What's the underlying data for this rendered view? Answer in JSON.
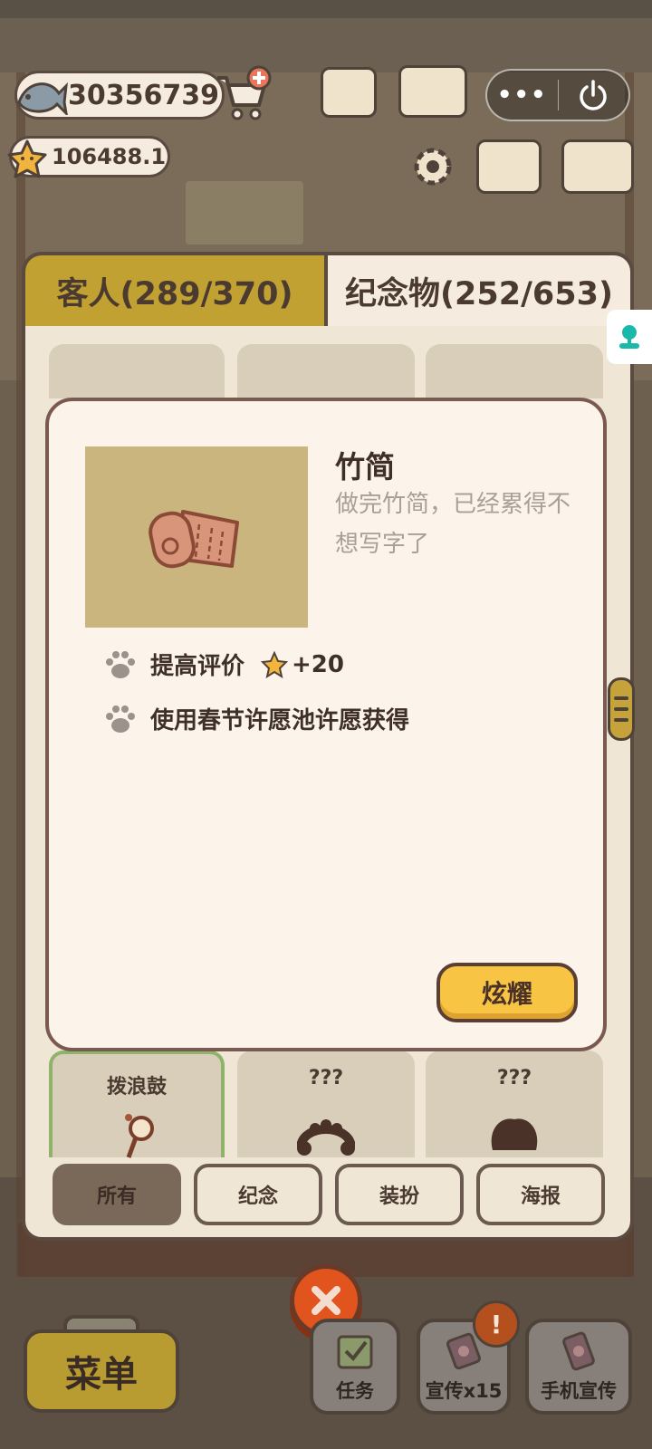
{
  "currency": {
    "fish": "30356739",
    "stars": "106488.1"
  },
  "tabs": {
    "guests": "客人(289/370)",
    "souvenirs": "纪念物(252/653)"
  },
  "grid": {
    "visible_labels": [
      "拨浪鼓",
      "???",
      "???"
    ]
  },
  "filters": {
    "items": [
      "所有",
      "纪念",
      "装扮",
      "海报"
    ],
    "active": "所有"
  },
  "modal": {
    "item_name": "竹简",
    "description": "做完竹简，已经累得不想写字了",
    "rating_label": "提高评价",
    "rating_value": "+20",
    "source": "使用春节许愿池许愿获得",
    "show_button": "炫耀"
  },
  "bottom_bar": {
    "menu": "菜单",
    "tasks": "任务",
    "promote": "宣传x15",
    "phone_promote": "手机宣传",
    "alert": "!"
  },
  "icons": {
    "fish": "fish-icon",
    "star": "star-icon",
    "cart": "cart-add-icon",
    "more": "more-dots-icon",
    "power": "power-icon",
    "close": "close-icon",
    "paw": "paw-icon"
  },
  "colors": {
    "accent_gold": "#c2a133",
    "button_yellow": "#f7c443",
    "close_orange": "#e1541e",
    "panel_cream": "#fcf4ea"
  }
}
